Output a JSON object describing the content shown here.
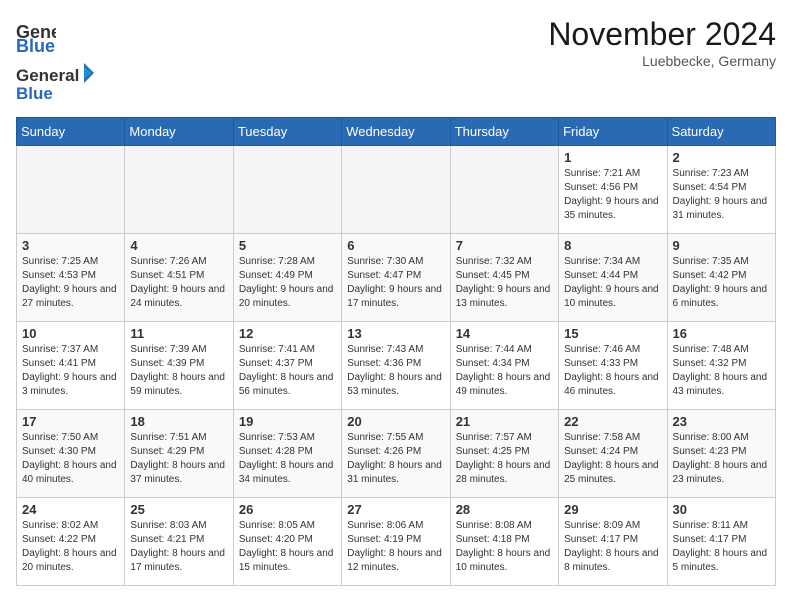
{
  "header": {
    "logo_general": "General",
    "logo_blue": "Blue",
    "month_title": "November 2024",
    "location": "Luebbecke, Germany"
  },
  "weekdays": [
    "Sunday",
    "Monday",
    "Tuesday",
    "Wednesday",
    "Thursday",
    "Friday",
    "Saturday"
  ],
  "weeks": [
    [
      {
        "day": "",
        "empty": true
      },
      {
        "day": "",
        "empty": true
      },
      {
        "day": "",
        "empty": true
      },
      {
        "day": "",
        "empty": true
      },
      {
        "day": "",
        "empty": true
      },
      {
        "day": "1",
        "sunrise": "7:21 AM",
        "sunset": "4:56 PM",
        "daylight": "9 hours and 35 minutes."
      },
      {
        "day": "2",
        "sunrise": "7:23 AM",
        "sunset": "4:54 PM",
        "daylight": "9 hours and 31 minutes."
      }
    ],
    [
      {
        "day": "3",
        "sunrise": "7:25 AM",
        "sunset": "4:53 PM",
        "daylight": "9 hours and 27 minutes."
      },
      {
        "day": "4",
        "sunrise": "7:26 AM",
        "sunset": "4:51 PM",
        "daylight": "9 hours and 24 minutes."
      },
      {
        "day": "5",
        "sunrise": "7:28 AM",
        "sunset": "4:49 PM",
        "daylight": "9 hours and 20 minutes."
      },
      {
        "day": "6",
        "sunrise": "7:30 AM",
        "sunset": "4:47 PM",
        "daylight": "9 hours and 17 minutes."
      },
      {
        "day": "7",
        "sunrise": "7:32 AM",
        "sunset": "4:45 PM",
        "daylight": "9 hours and 13 minutes."
      },
      {
        "day": "8",
        "sunrise": "7:34 AM",
        "sunset": "4:44 PM",
        "daylight": "9 hours and 10 minutes."
      },
      {
        "day": "9",
        "sunrise": "7:35 AM",
        "sunset": "4:42 PM",
        "daylight": "9 hours and 6 minutes."
      }
    ],
    [
      {
        "day": "10",
        "sunrise": "7:37 AM",
        "sunset": "4:41 PM",
        "daylight": "9 hours and 3 minutes."
      },
      {
        "day": "11",
        "sunrise": "7:39 AM",
        "sunset": "4:39 PM",
        "daylight": "8 hours and 59 minutes."
      },
      {
        "day": "12",
        "sunrise": "7:41 AM",
        "sunset": "4:37 PM",
        "daylight": "8 hours and 56 minutes."
      },
      {
        "day": "13",
        "sunrise": "7:43 AM",
        "sunset": "4:36 PM",
        "daylight": "8 hours and 53 minutes."
      },
      {
        "day": "14",
        "sunrise": "7:44 AM",
        "sunset": "4:34 PM",
        "daylight": "8 hours and 49 minutes."
      },
      {
        "day": "15",
        "sunrise": "7:46 AM",
        "sunset": "4:33 PM",
        "daylight": "8 hours and 46 minutes."
      },
      {
        "day": "16",
        "sunrise": "7:48 AM",
        "sunset": "4:32 PM",
        "daylight": "8 hours and 43 minutes."
      }
    ],
    [
      {
        "day": "17",
        "sunrise": "7:50 AM",
        "sunset": "4:30 PM",
        "daylight": "8 hours and 40 minutes."
      },
      {
        "day": "18",
        "sunrise": "7:51 AM",
        "sunset": "4:29 PM",
        "daylight": "8 hours and 37 minutes."
      },
      {
        "day": "19",
        "sunrise": "7:53 AM",
        "sunset": "4:28 PM",
        "daylight": "8 hours and 34 minutes."
      },
      {
        "day": "20",
        "sunrise": "7:55 AM",
        "sunset": "4:26 PM",
        "daylight": "8 hours and 31 minutes."
      },
      {
        "day": "21",
        "sunrise": "7:57 AM",
        "sunset": "4:25 PM",
        "daylight": "8 hours and 28 minutes."
      },
      {
        "day": "22",
        "sunrise": "7:58 AM",
        "sunset": "4:24 PM",
        "daylight": "8 hours and 25 minutes."
      },
      {
        "day": "23",
        "sunrise": "8:00 AM",
        "sunset": "4:23 PM",
        "daylight": "8 hours and 23 minutes."
      }
    ],
    [
      {
        "day": "24",
        "sunrise": "8:02 AM",
        "sunset": "4:22 PM",
        "daylight": "8 hours and 20 minutes."
      },
      {
        "day": "25",
        "sunrise": "8:03 AM",
        "sunset": "4:21 PM",
        "daylight": "8 hours and 17 minutes."
      },
      {
        "day": "26",
        "sunrise": "8:05 AM",
        "sunset": "4:20 PM",
        "daylight": "8 hours and 15 minutes."
      },
      {
        "day": "27",
        "sunrise": "8:06 AM",
        "sunset": "4:19 PM",
        "daylight": "8 hours and 12 minutes."
      },
      {
        "day": "28",
        "sunrise": "8:08 AM",
        "sunset": "4:18 PM",
        "daylight": "8 hours and 10 minutes."
      },
      {
        "day": "29",
        "sunrise": "8:09 AM",
        "sunset": "4:17 PM",
        "daylight": "8 hours and 8 minutes."
      },
      {
        "day": "30",
        "sunrise": "8:11 AM",
        "sunset": "4:17 PM",
        "daylight": "8 hours and 5 minutes."
      }
    ]
  ],
  "labels": {
    "sunrise": "Sunrise:",
    "sunset": "Sunset:",
    "daylight": "Daylight:"
  }
}
